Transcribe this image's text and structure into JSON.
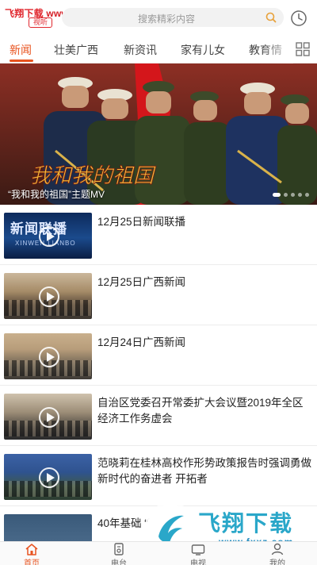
{
  "watermark": {
    "brand": "飞翔下载",
    "url": "www.FXXZ.com",
    "bottom_title": "飞翔下载",
    "bottom_url": "www.fxxz.com"
  },
  "header": {
    "logo_text": "视听",
    "search_placeholder": "搜索精彩内容"
  },
  "tabs": [
    {
      "label": "新闻",
      "active": true
    },
    {
      "label": "壮美广西",
      "active": false
    },
    {
      "label": "新资讯",
      "active": false
    },
    {
      "label": "家有儿女",
      "active": false
    },
    {
      "label": "教育情",
      "active": false
    }
  ],
  "banner": {
    "caption": "“我和我的祖国”主题MV",
    "overlay_text": "我和我的祖国",
    "slides": 5,
    "active_slide": 1
  },
  "news": [
    {
      "title": "12月25日新闻联播",
      "thumb_text": "新闻联播",
      "thumb_sub": "XINWEN LIANBO"
    },
    {
      "title": "12月25日广西新闻"
    },
    {
      "title": "12月24日广西新闻"
    },
    {
      "title": "自治区党委召开常委扩大会议暨2019年全区经济工作务虚会"
    },
    {
      "title": "范晓莉在桂林高校作形势政策报告时强调勇做新时代的奋进者 开拓者"
    },
    {
      "title": "40年基础 “新高..."
    }
  ],
  "nav": [
    {
      "label": "首页",
      "icon": "home-icon",
      "active": true
    },
    {
      "label": "电台",
      "icon": "radio-icon",
      "active": false
    },
    {
      "label": "电视",
      "icon": "tv-icon",
      "active": false
    },
    {
      "label": "",
      "icon": "",
      "active": false
    },
    {
      "label": "我的",
      "icon": "user-icon",
      "active": false
    }
  ],
  "colors": {
    "accent": "#e8531f",
    "watermark_red": "#e0262d"
  }
}
